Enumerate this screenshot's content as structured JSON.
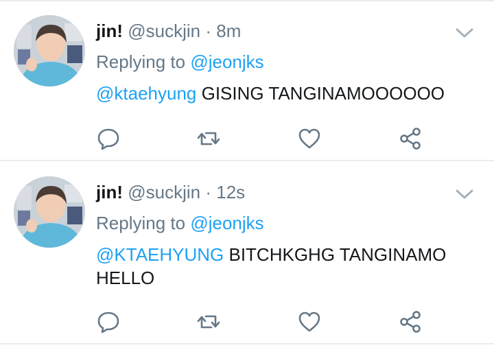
{
  "tweets": [
    {
      "name": "jin!",
      "handle": "@suckjin",
      "separator": "·",
      "time": "8m",
      "replying_prefix": "Replying to",
      "replying_to": "@jeonjks",
      "mention": "@ktaehyung",
      "text": " GISING TANGINAMOOOOOO",
      "avatar_icon": "profile-photo",
      "actions": [
        "reply-icon",
        "retweet-icon",
        "like-icon",
        "share-icon"
      ]
    },
    {
      "name": "jin!",
      "handle": "@suckjin",
      "separator": "·",
      "time": "12s",
      "replying_prefix": "Replying to",
      "replying_to": "@jeonjks",
      "mention": "@KTAEHYUNG",
      "text": " BITCHKGHG TANGINAMO HELLO",
      "avatar_icon": "profile-photo",
      "actions": [
        "reply-icon",
        "retweet-icon",
        "like-icon",
        "share-icon"
      ]
    }
  ],
  "colors": {
    "accent": "#1da1f2",
    "text": "#14171a",
    "secondary": "#657786",
    "divider": "#e6ecf0"
  }
}
